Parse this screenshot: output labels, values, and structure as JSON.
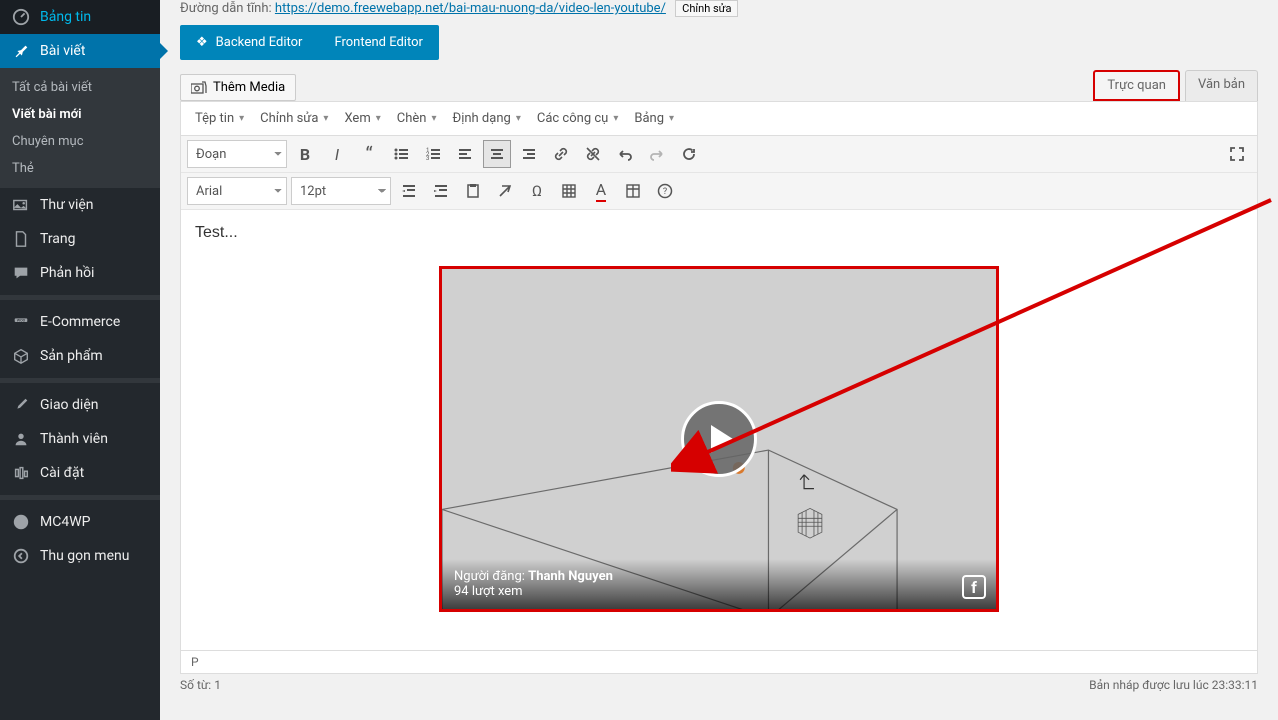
{
  "sidebar": {
    "items": [
      {
        "icon": "dashboard",
        "label": "Bảng tin"
      },
      {
        "icon": "pin",
        "label": "Bài viết",
        "active": true,
        "sub": [
          {
            "label": "Tất cả bài viết"
          },
          {
            "label": "Viết bài mới",
            "current": true
          },
          {
            "label": "Chuyên mục"
          },
          {
            "label": "Thẻ"
          }
        ]
      },
      {
        "icon": "media",
        "label": "Thư viện"
      },
      {
        "icon": "page",
        "label": "Trang"
      },
      {
        "icon": "comment",
        "label": "Phản hồi"
      },
      {
        "sep": true
      },
      {
        "icon": "cart",
        "label": "E-Commerce"
      },
      {
        "icon": "box",
        "label": "Sản phẩm"
      },
      {
        "sep": true
      },
      {
        "icon": "brush",
        "label": "Giao diện"
      },
      {
        "icon": "user",
        "label": "Thành viên"
      },
      {
        "icon": "settings",
        "label": "Cài đặt"
      },
      {
        "sep": true
      },
      {
        "icon": "mc",
        "label": "MC4WP"
      },
      {
        "icon": "collapse",
        "label": "Thu gọn menu"
      }
    ]
  },
  "permalink": {
    "prefix": "Đường dẫn tĩnh:",
    "url": "https://demo.freewebapp.net/bai-mau-nuong-da/video-len-youtube/",
    "edit": "Chỉnh sửa"
  },
  "editorSwitch": {
    "backend": "Backend Editor",
    "frontend": "Frontend Editor"
  },
  "addMedia": "Thêm Media",
  "tabs": {
    "visual": "Trực quan",
    "text": "Văn bản"
  },
  "menubar": [
    "Tệp tin",
    "Chỉnh sửa",
    "Xem",
    "Chèn",
    "Định dạng",
    "Các công cụ",
    "Bảng"
  ],
  "format": {
    "para": "Đoạn",
    "font": "Arial",
    "size": "12pt"
  },
  "content": {
    "text": "Test..."
  },
  "video": {
    "poster_by_label": "Người đăng:",
    "poster": "Thanh Nguyen",
    "views": "94 lượt xem"
  },
  "status": {
    "path": "P",
    "words_label": "Số từ:",
    "words": "1",
    "draft_label": "Bản nháp được lưu lúc",
    "draft_time": "23:33:11"
  }
}
